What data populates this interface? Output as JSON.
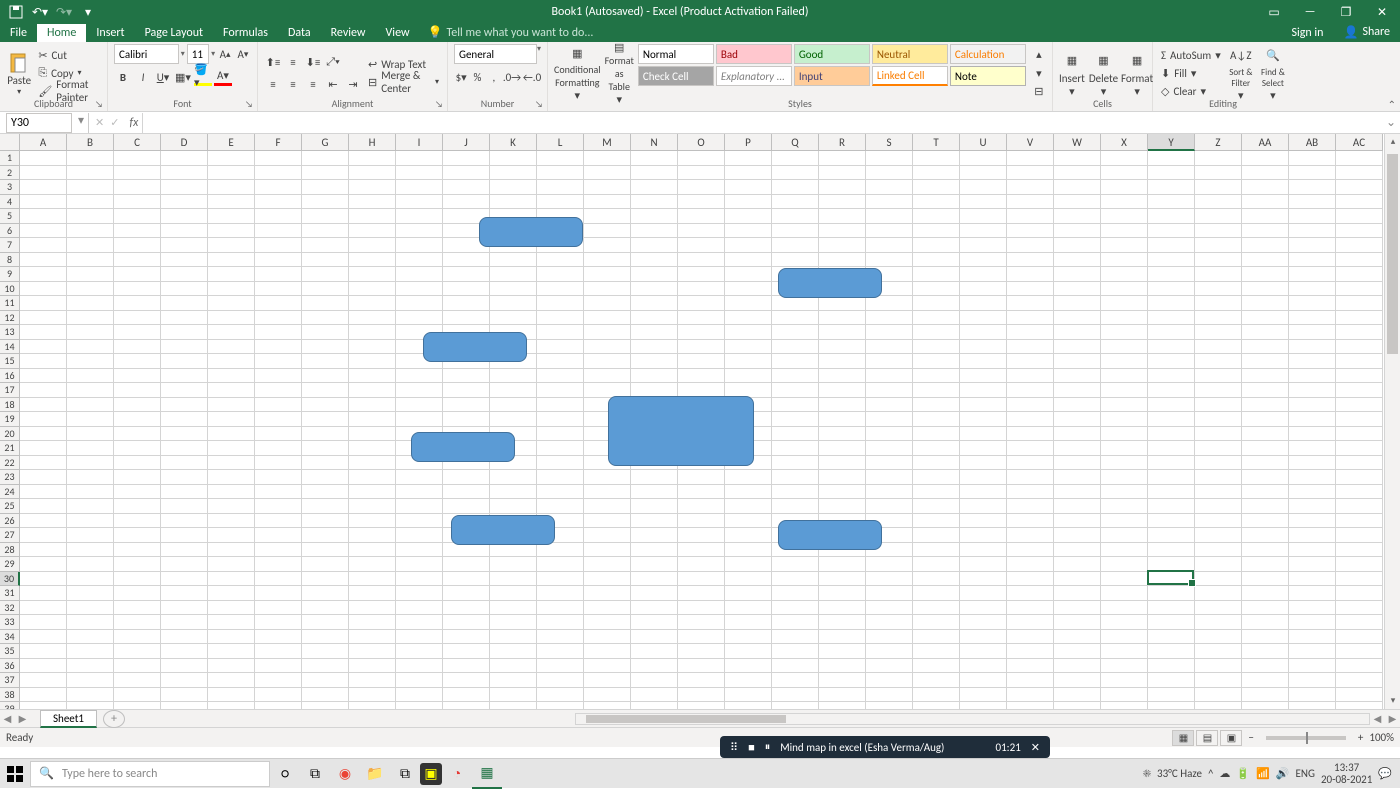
{
  "title": "Book1 (Autosaved) - Excel (Product Activation Failed)",
  "tabs": [
    "File",
    "Home",
    "Insert",
    "Page Layout",
    "Formulas",
    "Data",
    "Review",
    "View"
  ],
  "tellme": "Tell me what you want to do...",
  "signin": "Sign in",
  "share": "Share",
  "clipboard": {
    "label": "Clipboard",
    "paste": "Paste",
    "cut": "Cut",
    "copy": "Copy",
    "format_painter": "Format Painter"
  },
  "font": {
    "label": "Font",
    "name": "Calibri",
    "size": "11"
  },
  "alignment": {
    "label": "Alignment",
    "wrap": "Wrap Text",
    "merge": "Merge & Center"
  },
  "number": {
    "label": "Number",
    "format": "General"
  },
  "styles": {
    "label": "Styles",
    "cond": "Conditional Formatting",
    "table": "Format as Table",
    "n0": "Normal",
    "n1": "Bad",
    "n2": "Good",
    "n3": "Neutral",
    "n4": "Calculation",
    "n5": "Check Cell",
    "n6": "Explanatory ...",
    "n7": "Input",
    "n8": "Linked Cell",
    "n9": "Note"
  },
  "cells": {
    "label": "Cells",
    "insert": "Insert",
    "delete": "Delete",
    "format": "Format"
  },
  "editing": {
    "label": "Editing",
    "autosum": "AutoSum",
    "fill": "Fill",
    "clear": "Clear",
    "sort": "Sort & Filter",
    "find": "Find & Select"
  },
  "namebox": "Y30",
  "columns": [
    "A",
    "B",
    "C",
    "D",
    "E",
    "F",
    "G",
    "H",
    "I",
    "J",
    "K",
    "L",
    "M",
    "N",
    "O",
    "P",
    "Q",
    "R",
    "S",
    "T",
    "U",
    "V",
    "W",
    "X",
    "Y",
    "Z",
    "AA",
    "AB",
    "AC"
  ],
  "active_col": "Y",
  "rows": 39,
  "active_row": 30,
  "sheet_tab": "Sheet1",
  "status": "Ready",
  "zoom": "100%",
  "recording": {
    "title": "Mind map in excel (Esha Verma/Aug)",
    "time": "01:21"
  },
  "taskbar": {
    "search_placeholder": "Type here to search",
    "weather": "33°C Haze",
    "lang": "ENG",
    "time": "13:37",
    "date": "20-08-2021"
  }
}
